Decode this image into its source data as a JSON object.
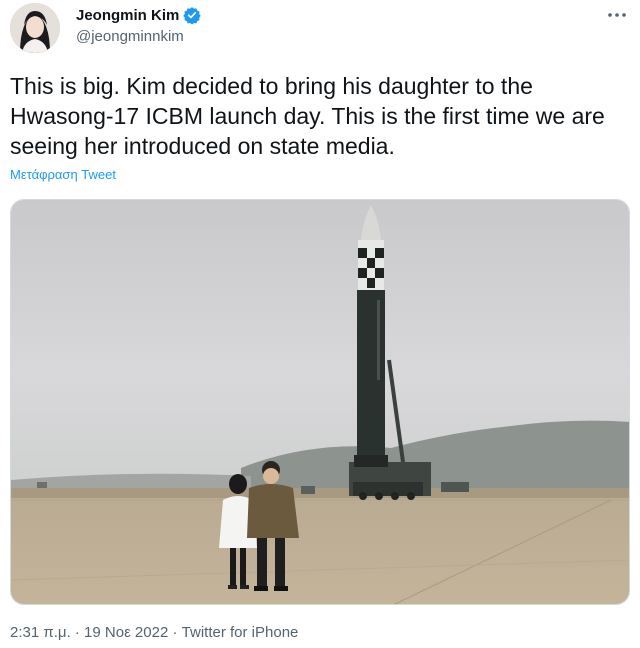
{
  "author": {
    "display_name": "Jeongmin Kim",
    "handle": "@jeongminnkim",
    "verified": true,
    "verified_color": "#1d9bf0"
  },
  "tweet": {
    "text": "This is big. Kim decided to bring his daughter to the Hwasong-17 ICBM launch day. This is the first time we are seeing her introduced on state media.",
    "translate_label": "Μετάφραση Tweet",
    "time": "2:31 π.μ.",
    "separator_1": " · ",
    "date": "19 Νοε 2022",
    "separator_2": " · ",
    "source": "Twitter for iPhone"
  },
  "icons": {
    "more": "more-horizontal-icon",
    "verified": "verified-badge-icon"
  },
  "colors": {
    "link": "#1d9bf0",
    "secondary_text": "#536471",
    "primary_text": "#0f1419"
  }
}
